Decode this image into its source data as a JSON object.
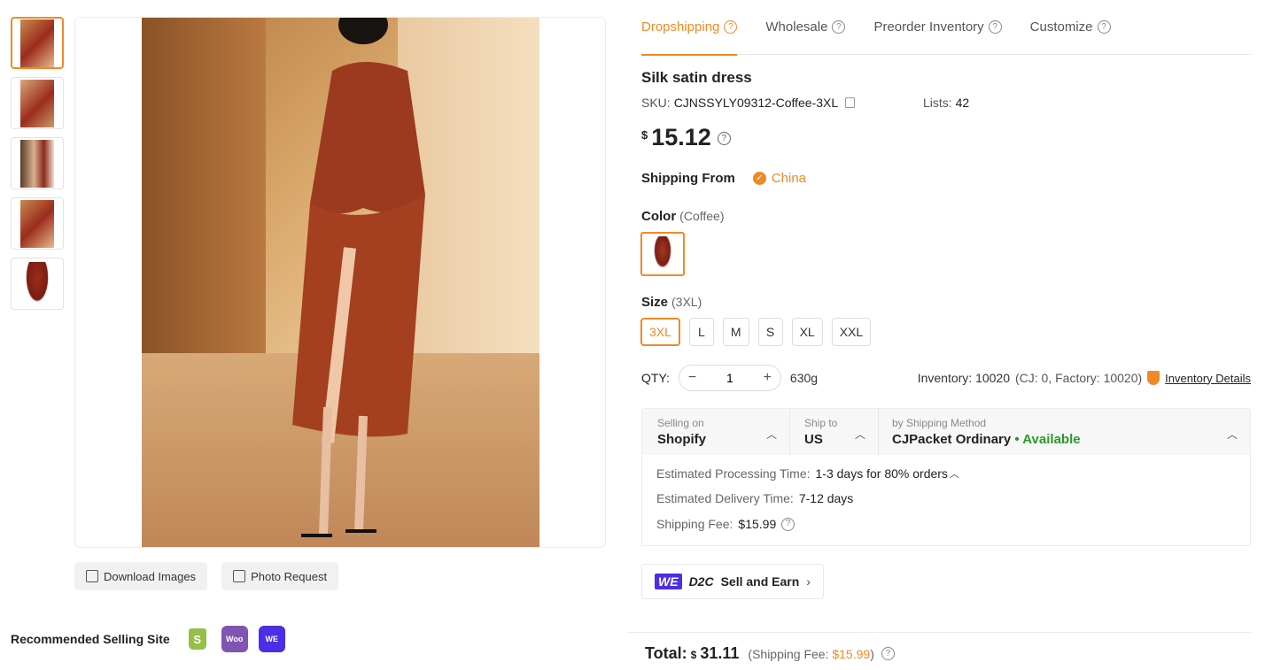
{
  "thumbnails": [
    "photo-1",
    "photo-2",
    "photo-3",
    "photo-4",
    "product-only"
  ],
  "image_buttons": {
    "download": "Download Images",
    "photo_request": "Photo Request"
  },
  "recommended": {
    "label": "Recommended Selling Site",
    "sites": [
      "Shopify",
      "WooCommerce",
      "WE D2C"
    ]
  },
  "tabs": [
    "Dropshipping",
    "Wholesale",
    "Preorder Inventory",
    "Customize"
  ],
  "product": {
    "title": "Silk satin dress",
    "sku_label": "SKU:",
    "sku": "CJNSSYLY09312-Coffee-3XL",
    "lists_label": "Lists:",
    "lists": "42",
    "price_currency": "$",
    "price": "15.12"
  },
  "shipping_from": {
    "label": "Shipping From",
    "value": "China"
  },
  "color": {
    "label": "Color",
    "selected": "(Coffee)"
  },
  "size": {
    "label": "Size",
    "selected": "(3XL)",
    "options": [
      "3XL",
      "L",
      "M",
      "S",
      "XL",
      "XXL"
    ]
  },
  "qty": {
    "label": "QTY:",
    "value": "1",
    "weight": "630g",
    "inventory": "Inventory: 10020",
    "inventory_sub": "(CJ: 0, Factory: 10020)",
    "details_link": "Inventory Details"
  },
  "ship_box": {
    "selling_on_label": "Selling on",
    "selling_on": "Shopify",
    "ship_to_label": "Ship to",
    "ship_to": "US",
    "method_label": "by Shipping Method",
    "method": "CJPacket Ordinary",
    "availability": "• Available",
    "processing_label": "Estimated Processing Time:",
    "processing": "1-3 days for 80% orders",
    "delivery_label": "Estimated Delivery Time:",
    "delivery": "7-12 days",
    "fee_label": "Shipping Fee:",
    "fee": "$15.99"
  },
  "d2c": {
    "logo1": "WE",
    "logo2": "D2C",
    "label": "Sell and Earn"
  },
  "total": {
    "label": "Total:",
    "currency": "$",
    "amount": "31.11",
    "fee_prefix": "(Shipping Fee: ",
    "fee": "$15.99",
    "fee_suffix": ")"
  },
  "colors": {
    "accent": "#f08a24",
    "available": "#2a9a2a",
    "d2c_brand": "#4c2ee6"
  }
}
